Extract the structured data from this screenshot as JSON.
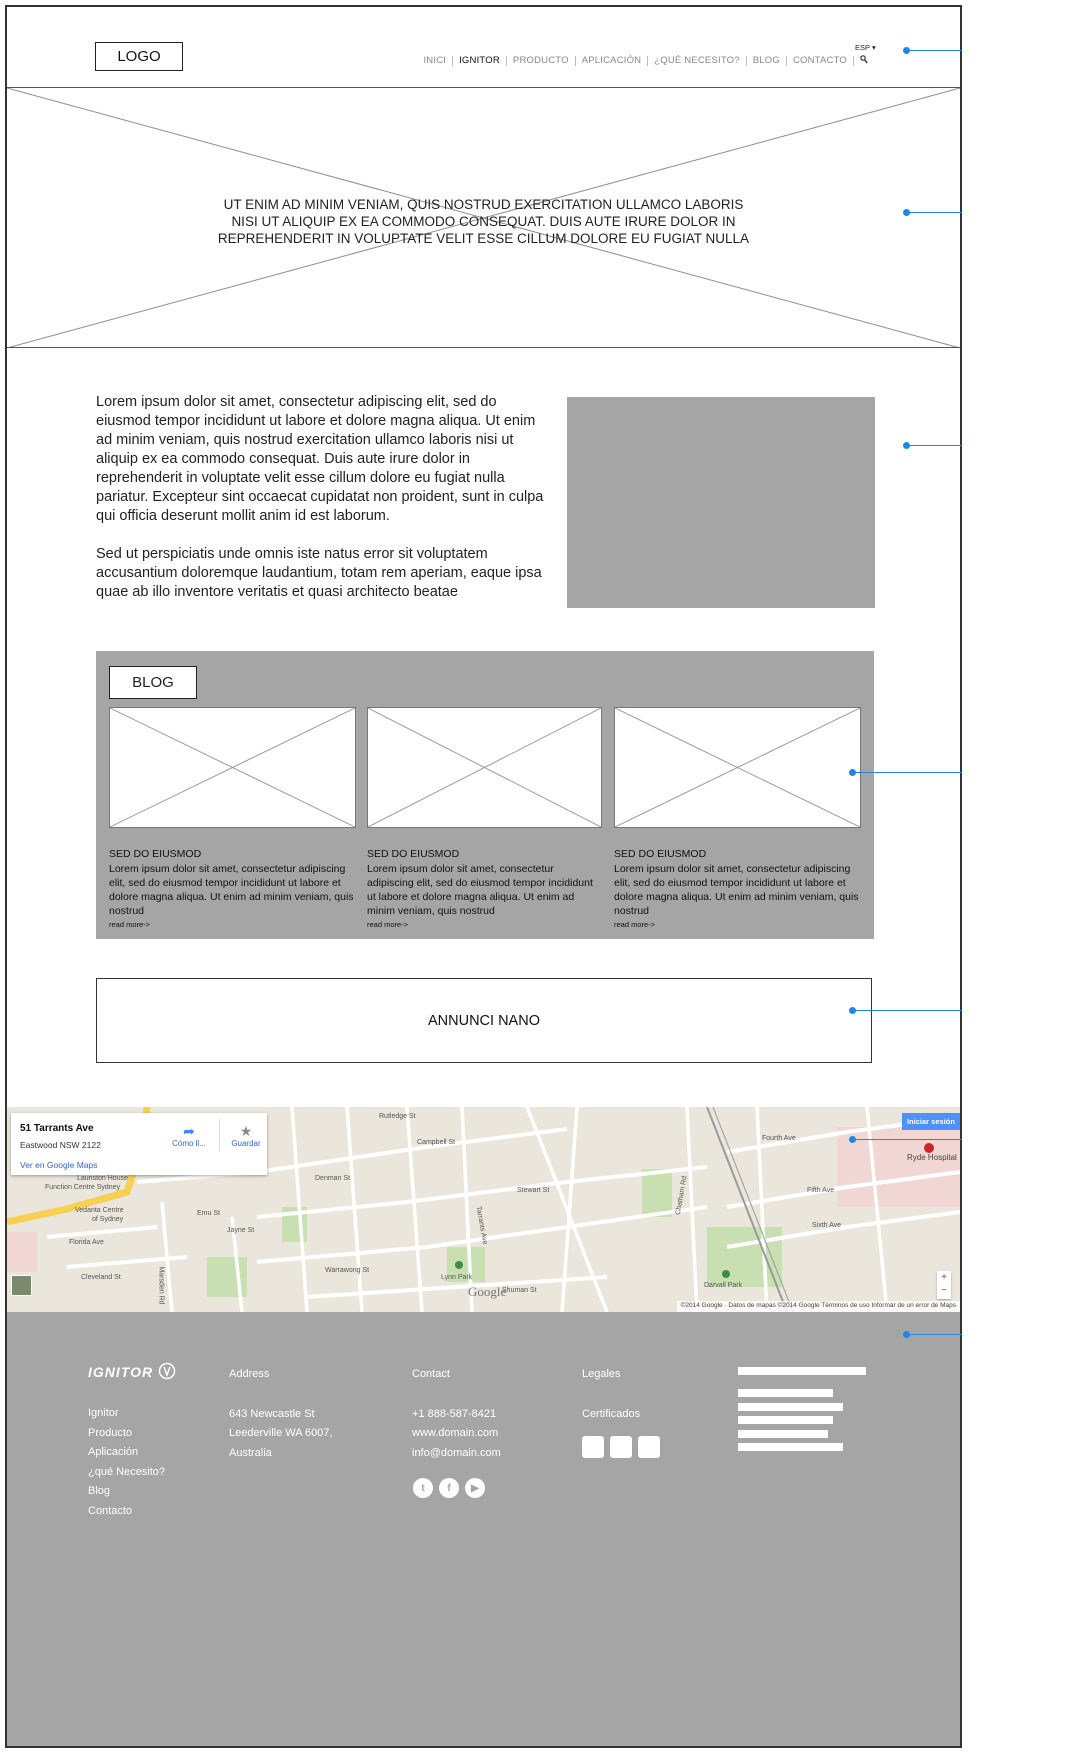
{
  "header": {
    "logo_label": "LOGO",
    "language": "ESP",
    "nav": [
      "INICI",
      "IGNITOR",
      "PRODUCTO",
      "APLICACIÓN",
      "¿QUÉ NECESITO?",
      "BLOG",
      "CONTACTO"
    ],
    "active_nav": "IGNITOR",
    "search_icon": "search-icon"
  },
  "hero": {
    "text_line1": "UT ENIM AD MINIM VENIAM, QUIS NOSTRUD EXERCITATION ULLAMCO LABORIS",
    "text_line2": "NISI UT ALIQUIP EX EA COMMODO CONSEQUAT. DUIS AUTE IRURE DOLOR IN",
    "text_line3": "REPREHENDERIT IN VOLUPTATE VELIT ESSE CILLUM DOLORE EU FUGIAT NULLA"
  },
  "intro": {
    "paragraph1": "Lorem ipsum dolor sit amet, consectetur adipiscing elit, sed do eiusmod tempor incididunt ut labore et dolore magna aliqua. Ut enim ad minim veniam, quis nostrud exercitation ullamco laboris nisi ut aliquip ex ea commodo consequat. Duis aute irure dolor in reprehenderit in voluptate velit esse cillum dolore eu fugiat nulla pariatur. Excepteur sint occaecat cupidatat non proident, sunt in culpa qui officia deserunt mollit anim id est laborum.",
    "paragraph2": "Sed ut perspiciatis unde omnis iste natus error sit voluptatem accusantium doloremque laudantium, totam rem aperiam, eaque ipsa quae ab illo inventore veritatis et quasi architecto beatae"
  },
  "blog": {
    "title": "BLOG",
    "cards": [
      {
        "heading": "SED DO EIUSMOD",
        "text": "Lorem ipsum dolor sit amet, consectetur adipiscing elit, sed do eiusmod tempor incididunt ut labore et dolore magna aliqua. Ut enim ad minim veniam, quis nostrud",
        "more": "read more->"
      },
      {
        "heading": "SED DO EIUSMOD",
        "text": "Lorem ipsum dolor sit amet, consectetur adipiscing elit, sed do eiusmod tempor incididunt ut labore et dolore magna aliqua. Ut enim ad minim veniam, quis nostrud",
        "more": "read more->"
      },
      {
        "heading": "SED DO EIUSMOD",
        "text": "Lorem ipsum dolor sit amet, consectetur adipiscing elit, sed do eiusmod tempor incididunt ut labore et dolore magna aliqua. Ut enim ad minim veniam, quis nostrud",
        "more": "read more->"
      }
    ]
  },
  "ad": {
    "label": "ANNUNCI NANO"
  },
  "map": {
    "address": "51 Tarrants Ave",
    "suburb": "Eastwood NSW 2122",
    "directions": "Cómo ll...",
    "save": "Guardar",
    "view_link": "Ver en Google Maps",
    "signin": "Iniciar sesión",
    "google": "Google",
    "attribution": "©2014 Google · Datos de mapas ©2014 Google   Términos de uso   Informar de un error de Maps",
    "labels": {
      "rutledge": "Rutledge St",
      "campbell": "Campbell St",
      "fourth": "Fourth Ave",
      "ryde_hospital": "Ryde Hospital",
      "lauriston": "Lauriston House",
      "function": "Function Centre Sydney",
      "vedanta": "Vedanta Centre",
      "of_sydney": "of Sydney",
      "florida": "Florida Ave",
      "cleveland": "Cleveland St",
      "denman": "Denman St",
      "stewart": "Stewart St",
      "emu": "Emu St",
      "jayne": "Jayne St",
      "warrawong": "Warrawong St",
      "lynn_park": "Lynn Park",
      "darvall_park": "Darvall Park",
      "fifth": "Fifth Ave",
      "sixth": "Sixth Ave",
      "chatham": "Chatham Rd",
      "tarrants": "Tarrants Ave",
      "marsden": "Marsden Rd",
      "shuman": "Shuman St"
    }
  },
  "footer": {
    "brand": "IGNITOR",
    "links": [
      "Ignitor",
      "Producto",
      "Aplicación",
      "¿qué Necesito?",
      "Blog",
      "Contacto"
    ],
    "address_heading": "Address",
    "address_lines": [
      "643 Newcastle St",
      "Leederville WA 6007,",
      "Australia"
    ],
    "contact_heading": "Contact",
    "contact_lines": [
      "+1 888-587-8421",
      "www.domain.com",
      "info@domain.com"
    ],
    "legal_heading": "Legales",
    "legal_item": "Certificados",
    "social_icons": [
      "twitter-icon",
      "facebook-icon",
      "youtube-icon"
    ]
  }
}
